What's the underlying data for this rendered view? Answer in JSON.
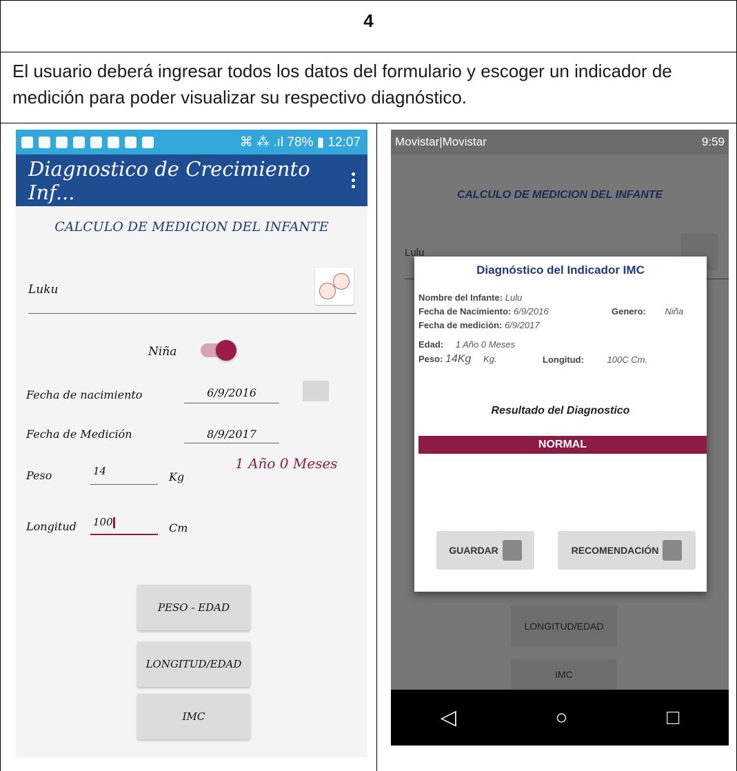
{
  "row_number": "4",
  "description": "El usuario deberá ingresar todos los datos del formulario y escoger un indicador de medición para poder visualizar su respectivo diagnóstico.",
  "left_screen": {
    "status_bar": {
      "right": "⌘ ⁂ .ıl 78% ▮ 12:07"
    },
    "app_title": "Diagnostico de Crecimiento Inf...",
    "section_title": "CALCULO DE MEDICION DEL INFANTE",
    "name_value": "Luku",
    "gender_label": "Niña",
    "birth_label": "Fecha de nacimiento",
    "birth_value": "6/9/2016",
    "measure_label": "Fecha de Medición",
    "measure_value": "8/9/2017",
    "age_text": "1 Año 0 Meses",
    "weight_label": "Peso",
    "weight_value": "14",
    "weight_unit": "Kg",
    "length_label": "Longitud",
    "length_value": "100",
    "length_unit": "Cm",
    "buttons": [
      "PESO - EDAD",
      "LONGITUD/EDAD",
      "IMC"
    ]
  },
  "right_screen": {
    "status_bar": {
      "left": "Movistar|Movistar",
      "right": "9:59"
    },
    "bg_title": "CALCULO DE MEDICION DEL INFANTE",
    "bg_name": "Lulu",
    "bg_buttons": [
      "LONGITUD/EDAD",
      "IMC"
    ],
    "dialog": {
      "title": "Diagnóstico del Indicador IMC",
      "name_label": "Nombre del Infante:",
      "name_value": "Lulu",
      "birth_label": "Fecha de Nacimiento:",
      "birth_value": "6/9/2016",
      "gender_label": "Genero:",
      "gender_value": "Niña",
      "measure_label": "Fecha de medición:",
      "measure_value": "6/9/2017",
      "age_label": "Edad:",
      "age_value": "1 Año 0 Meses",
      "weight_label": "Peso:",
      "weight_value": "14Kg",
      "weight_unit": "Kg.",
      "length_label": "Longitud:",
      "length_value": "100C Cm.",
      "result_title": "Resultado del Diagnostico",
      "result_value": "NORMAL",
      "save_label": "GUARDAR",
      "recommend_label": "RECOMENDACIÓN"
    }
  }
}
